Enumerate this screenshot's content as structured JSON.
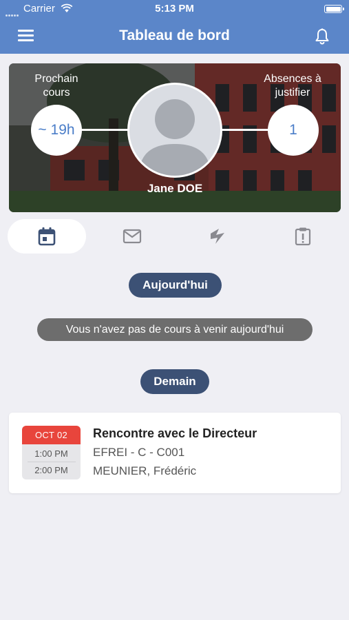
{
  "status_bar": {
    "carrier": "Carrier",
    "time": "5:13 PM",
    "battery_level": 1.0
  },
  "nav": {
    "title": "Tableau de bord",
    "menu_icon": "hamburger-menu-icon",
    "bell_icon": "bell-icon"
  },
  "hero": {
    "next_course_label": "Prochain cours",
    "next_course_value": "~ 19h",
    "absences_label": "Absences à justifier",
    "absences_value": "1",
    "user_name": "Jane DOE"
  },
  "tabs": [
    {
      "icon": "calendar-icon",
      "active": true
    },
    {
      "icon": "mail-icon",
      "active": false
    },
    {
      "icon": "lightning-icon",
      "active": false
    },
    {
      "icon": "clipboard-alert-icon",
      "active": false
    }
  ],
  "today": {
    "label": "Aujourd'hui",
    "notice": "Vous n'avez pas de cours à venir aujourd'hui"
  },
  "tomorrow": {
    "label": "Demain",
    "events": [
      {
        "date": "OCT 02",
        "start": "1:00 PM",
        "end": "2:00 PM",
        "title": "Rencontre avec le Directeur",
        "room": "EFREI - C - C001",
        "teacher": "MEUNIER, Frédéric"
      }
    ]
  },
  "colors": {
    "header": "#5b86c9",
    "pill": "#3c5175",
    "notice": "#6d6d6d",
    "date_head": "#e8453c",
    "accent_text": "#4a7dc8"
  }
}
